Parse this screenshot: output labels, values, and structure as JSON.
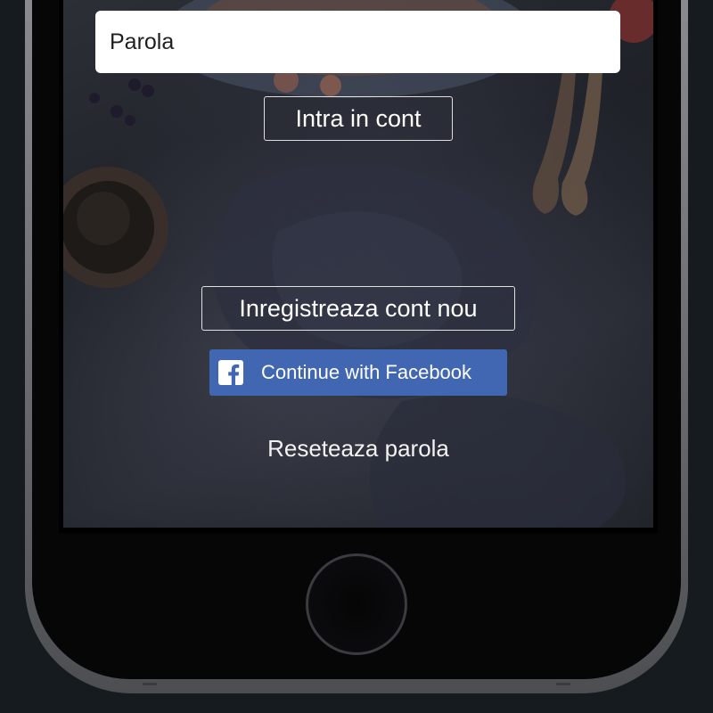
{
  "form": {
    "password_placeholder": "Parola",
    "login_button": "Intra in cont"
  },
  "actions": {
    "register_button": "Inregistreaza cont nou",
    "facebook_button": "Continue with Facebook",
    "reset_link": "Reseteaza parola"
  },
  "icons": {
    "facebook": "facebook-icon",
    "home": "home-button"
  },
  "colors": {
    "facebook_blue": "#4267b2",
    "button_border": "#ffffff",
    "background": "#161b20"
  }
}
